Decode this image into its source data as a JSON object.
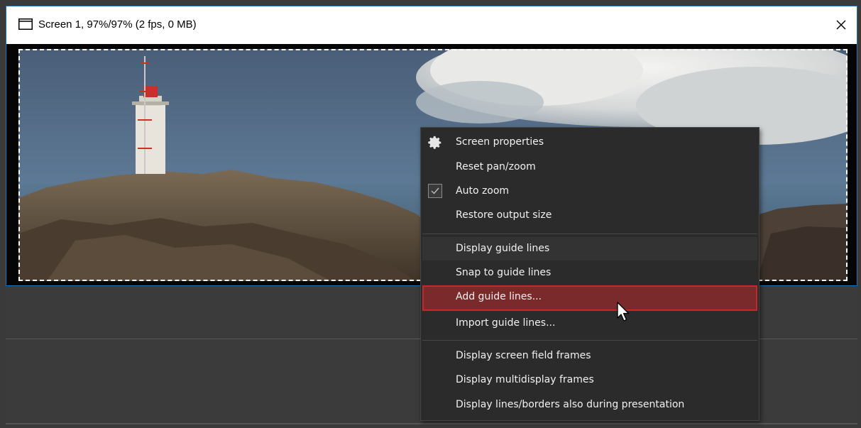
{
  "window": {
    "title": "Screen 1, 97%/97% (2 fps, 0 MB)",
    "icon": "window-icon",
    "close_icon": "close-icon"
  },
  "context_menu": {
    "items": [
      {
        "label": "Screen properties",
        "icon": "gear-icon"
      },
      {
        "label": "Reset pan/zoom"
      },
      {
        "label": "Auto zoom",
        "checked": true
      },
      {
        "label": "Restore output size"
      },
      {
        "label": "Display guide lines"
      },
      {
        "label": "Snap to guide lines"
      },
      {
        "label": "Add guide lines...",
        "highlighted": true
      },
      {
        "label": "Import guide lines..."
      },
      {
        "label": "Display screen field frames"
      },
      {
        "label": "Display multidisplay frames"
      },
      {
        "label": "Display lines/borders also during presentation"
      }
    ]
  },
  "colors": {
    "highlight_bg": "#7a2a2a",
    "highlight_border": "#c62828",
    "menu_bg": "#2b2b2b",
    "panel_bg": "#3b3b3b",
    "window_border": "#1f6fb5"
  }
}
